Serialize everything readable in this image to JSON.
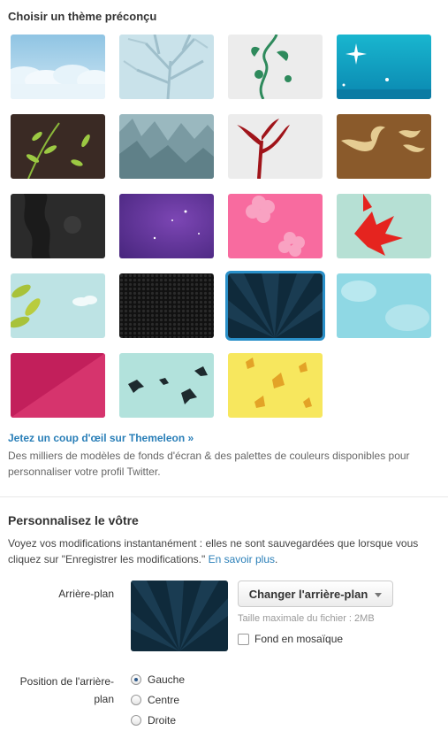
{
  "themes_section": {
    "title": "Choisir un thème préconçu",
    "themes": [
      {
        "name": "nuages"
      },
      {
        "name": "arbre"
      },
      {
        "name": "vigne"
      },
      {
        "name": "etoiles"
      },
      {
        "name": "feuilles-vertes"
      },
      {
        "name": "forêt"
      },
      {
        "name": "branche-rouge"
      },
      {
        "name": "oiseaux-or"
      },
      {
        "name": "gris-sombre"
      },
      {
        "name": "violet-etoiles"
      },
      {
        "name": "fleurs-roses"
      },
      {
        "name": "feuille-rouge"
      },
      {
        "name": "feuilles-jaunes"
      },
      {
        "name": "maille-noire"
      },
      {
        "name": "rayons-bleus"
      },
      {
        "name": "nuages-bleus"
      },
      {
        "name": "rose-magenta"
      },
      {
        "name": "oiseaux-noirs"
      },
      {
        "name": "feuilles-automne"
      }
    ],
    "selected_index": 14,
    "themeleon_link": "Jetez un coup d'œil sur Themeleon »",
    "themeleon_desc": "Des milliers de modèles de fonds d'écran & des palettes de couleurs disponibles pour personnaliser votre profil Twitter."
  },
  "custom_section": {
    "title": "Personnalisez le vôtre",
    "intro_text": "Voyez vos modifications instantanément : elles ne sont sauvegardées que lorsque vous cliquez sur \"Enregistrer les modifications.\"",
    "learn_more": "En savoir plus",
    "intro_end": ".",
    "background_label": "Arrière-plan",
    "change_button": "Changer l'arrière-plan",
    "max_size": "Taille maximale du fichier : 2MB",
    "tile_label": "Fond en mosaïque",
    "tile_checked": false,
    "position_label": "Position de l'arrière-plan",
    "positions": [
      "Gauche",
      "Centre",
      "Droite"
    ],
    "selected_position": "Gauche"
  },
  "colors": {
    "link": "#2a7fb8",
    "selected_outline": "#2a90c9"
  }
}
